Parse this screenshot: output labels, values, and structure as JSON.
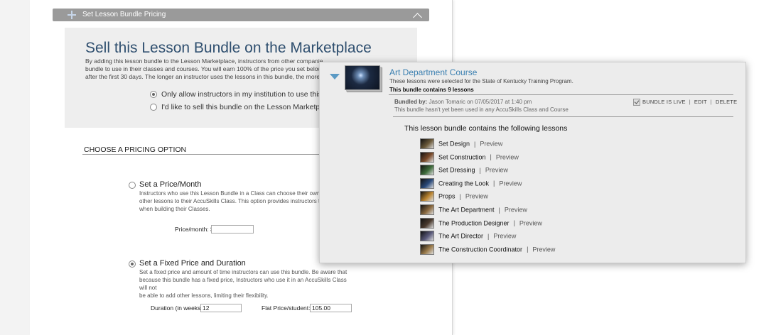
{
  "section": {
    "title": "Set Lesson Bundle Pricing"
  },
  "marketplace": {
    "title": "Sell this Lesson Bundle on the Marketplace",
    "description_lines": [
      "By adding this lesson bundle to the Lesson Marketplace, instructors from other companie",
      "bundle to use in their classes and courses. You will earn 100% of the price you set below,",
      "after the first 30 days. The longer an instructor uses the lessons in this bundle, the more y"
    ],
    "options": [
      {
        "label": "Only allow instructors in my institution to use this bu",
        "checked": true
      },
      {
        "label": "I'd like to sell this bundle on the Lesson Marketplace",
        "checked": false
      }
    ]
  },
  "pricing": {
    "heading": "CHOOSE A PRICING OPTION",
    "monthly": {
      "title": "Set a Price/Month",
      "checked": false,
      "desc_lines": [
        "Instructors who use this Lesson Bundle in a Class can choose their own du",
        "other lessons to their AccuSkills Class. This option provides instructors the",
        "when building their Classes."
      ],
      "price_label": "Price/month: $",
      "price_value": ""
    },
    "fixed": {
      "title": "Set a Fixed Price and Duration",
      "checked": true,
      "desc_lines": [
        "Set a fixed price and amount of time instructors can use this bundle. Be aware that",
        "because this bundle has a fixed price, Instructors who use it in an AccuSkills Class will not",
        "be able to add other lessons, limiting their flexibility."
      ],
      "duration_label": "Duration (in weeks):",
      "duration_value": "12",
      "flat_label": "Flat Price/student: $",
      "flat_value": "105.00"
    }
  },
  "bundle": {
    "title": "Art Department Course",
    "subtitle": "These lessons were selected for the State of Kentucky Training Program.",
    "count_text": "This bundle contains 9 lessons",
    "bundled_by_label": "Bundled by:",
    "bundled_by_value": "Jason Tomaric on 07/05/2017 at 1:40 pm",
    "usage_note": "This bundle hasn't yet been used in any AccuSkills Class and Course",
    "live_label": "BUNDLE IS LIVE",
    "live_checked": true,
    "edit_label": "EDIT",
    "delete_label": "DELETE",
    "contains_heading": "This lesson bundle contains the following lessons",
    "preview_label": "Preview",
    "lessons": [
      {
        "name": "Set Design",
        "thumb_color": "#6b5a3a"
      },
      {
        "name": "Set Construction",
        "thumb_color": "#7a4a2a"
      },
      {
        "name": "Set Dressing",
        "thumb_color": "#3d6b3a"
      },
      {
        "name": "Creating the Look",
        "thumb_color": "#2a4a7a"
      },
      {
        "name": "Props",
        "thumb_color": "#b8822e"
      },
      {
        "name": "The Art Department",
        "thumb_color": "#8a6a40"
      },
      {
        "name": "The Production Designer",
        "thumb_color": "#4a3a2e"
      },
      {
        "name": "The Art Director",
        "thumb_color": "#5a5a7a"
      },
      {
        "name": "The Construction Coordinator",
        "thumb_color": "#9a7a4a"
      }
    ]
  }
}
